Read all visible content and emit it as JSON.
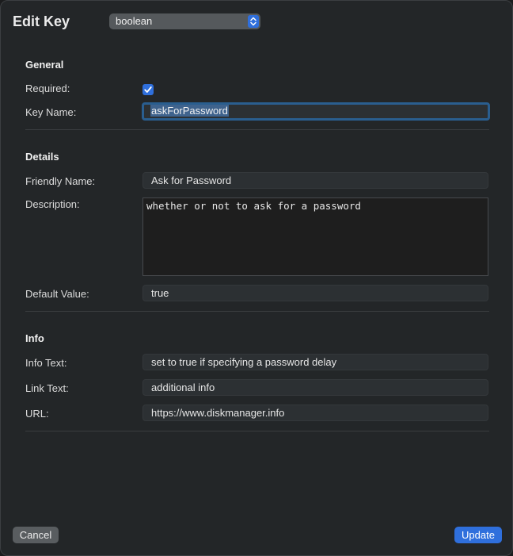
{
  "dialog": {
    "title": "Edit Key",
    "type_value": "boolean"
  },
  "general": {
    "heading": "General",
    "required_label": "Required:",
    "required_checked": true,
    "key_name_label": "Key Name:",
    "key_name_value": "askForPassword"
  },
  "details": {
    "heading": "Details",
    "friendly_name_label": "Friendly Name:",
    "friendly_name_value": "Ask for Password",
    "description_label": "Description:",
    "description_value": "whether or not to ask for a password",
    "default_value_label": "Default Value:",
    "default_value": "true"
  },
  "info": {
    "heading": "Info",
    "info_text_label": "Info Text:",
    "info_text_value": "set to true if specifying a password delay",
    "link_text_label": "Link Text:",
    "link_text_value": "additional info",
    "url_label": "URL:",
    "url_value": "https://www.diskmanager.info"
  },
  "buttons": {
    "cancel": "Cancel",
    "update": "Update"
  },
  "colors": {
    "accent": "#2f6fdc",
    "background": "#232628"
  }
}
